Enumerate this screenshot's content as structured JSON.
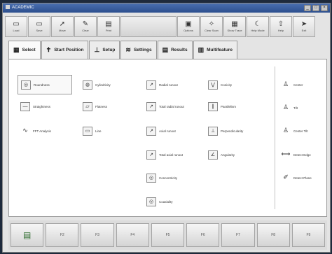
{
  "window": {
    "title": "ACADEMIC"
  },
  "toolbar": {
    "buttons": [
      {
        "label": "Load",
        "icon": "▭"
      },
      {
        "label": "Save",
        "icon": "▭"
      },
      {
        "label": "Move",
        "icon": "➚"
      },
      {
        "label": "Clear",
        "icon": "✎"
      },
      {
        "label": "Print",
        "icon": "▤"
      },
      {
        "label": "",
        "icon": ""
      },
      {
        "label": "Options",
        "icon": "▣"
      },
      {
        "label": "Clear Scan",
        "icon": "✧"
      },
      {
        "label": "Show Trace",
        "icon": "▦"
      },
      {
        "label": "Help Mode",
        "icon": "☾"
      },
      {
        "label": "Help",
        "icon": "⇧"
      },
      {
        "label": "Exit",
        "icon": "➤"
      }
    ]
  },
  "tabs": [
    {
      "label": "Select",
      "icon": "▦"
    },
    {
      "label": "Start Position",
      "icon": "✝"
    },
    {
      "label": "Setup",
      "icon": "⊥"
    },
    {
      "label": "Settings",
      "icon": "≋"
    },
    {
      "label": "Results",
      "icon": "▤"
    },
    {
      "label": "Multifeature",
      "icon": "▥"
    }
  ],
  "features": {
    "col1": [
      {
        "label": "Roundness",
        "icon": "◎"
      },
      {
        "label": "Straightness",
        "icon": "—"
      },
      {
        "label": "FFT Analysis",
        "icon": "∿"
      }
    ],
    "col2": [
      {
        "label": "Cylindricity",
        "icon": "◍"
      },
      {
        "label": "Flatness",
        "icon": "▱"
      },
      {
        "label": "Line",
        "icon": "▭"
      }
    ],
    "col3": [
      {
        "label": "Radial runout",
        "icon": "↗"
      },
      {
        "label": "Total radial runout",
        "icon": "↗"
      },
      {
        "label": "Axial runout",
        "icon": "↗"
      },
      {
        "label": "Total axial runout",
        "icon": "↗"
      },
      {
        "label": "Concentricity",
        "icon": "◎"
      },
      {
        "label": "Coaxiality",
        "icon": "◎"
      }
    ],
    "col4": [
      {
        "label": "Conicity",
        "icon": "⋁"
      },
      {
        "label": "Parallelism",
        "icon": "∥"
      },
      {
        "label": "Perpendicularity",
        "icon": "⊥"
      },
      {
        "label": "Angularity",
        "icon": "∠"
      }
    ],
    "col5": [
      {
        "label": "Center",
        "icon": "♙"
      },
      {
        "label": "Tilt",
        "icon": "♙"
      },
      {
        "label": "Center Tilt",
        "icon": "♙"
      },
      {
        "label": "Detect Edge",
        "icon": "⟷"
      },
      {
        "label": "Detect Plane",
        "icon": "✐"
      }
    ]
  },
  "fkeys": [
    "",
    "F2",
    "F3",
    "F4",
    "F5",
    "F6",
    "F7",
    "F8",
    "F9"
  ]
}
